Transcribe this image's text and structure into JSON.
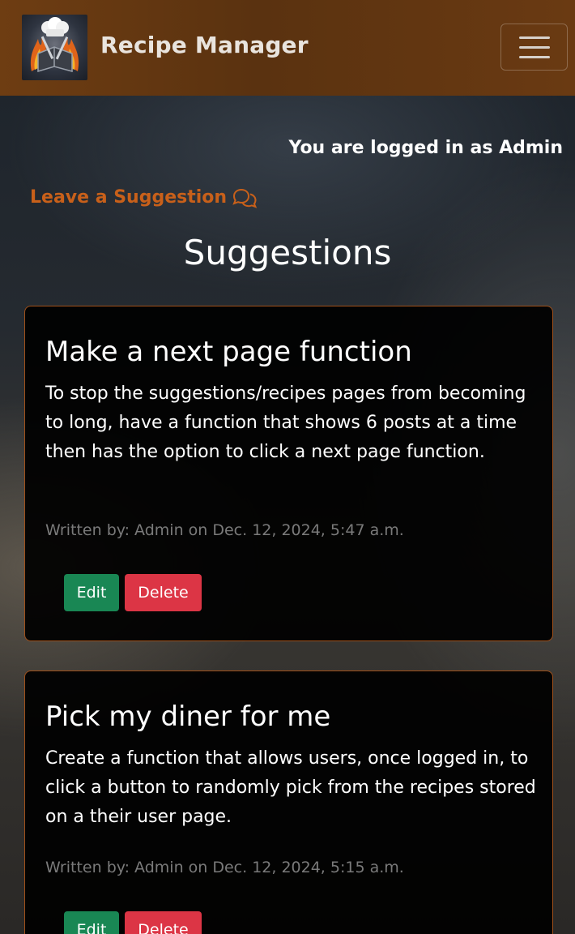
{
  "navbar": {
    "brand": "Recipe Manager",
    "logo_icon": "chef-logo-icon",
    "menu_icon": "hamburger-menu-icon",
    "background": "#5a3210"
  },
  "status": {
    "login_text": "You are logged in as Admin"
  },
  "suggestion_link": {
    "label": "Leave a Suggestion",
    "icon": "chat-bubbles-icon",
    "color": "#c8601a"
  },
  "page": {
    "title": "Suggestions"
  },
  "suggestions": [
    {
      "title": "Make a next page function",
      "body": "To stop the suggestions/recipes pages from becoming to long, have a function that shows 6 posts at a time then has the option to click a next page function.",
      "meta": "Written by: Admin on Dec. 12, 2024, 5:47 a.m.",
      "edit_label": "Edit",
      "delete_label": "Delete"
    },
    {
      "title": "Pick my diner for me",
      "body": "Create a function that allows users, once logged in, to click a button to randomly pick from the recipes stored on a their user page.",
      "meta": "Written by: Admin on Dec. 12, 2024, 5:15 a.m.",
      "edit_label": "Edit",
      "delete_label": "Delete"
    }
  ],
  "colors": {
    "edit_button": "#198754",
    "delete_button": "#dc3545",
    "card_border": "#a0501a"
  }
}
